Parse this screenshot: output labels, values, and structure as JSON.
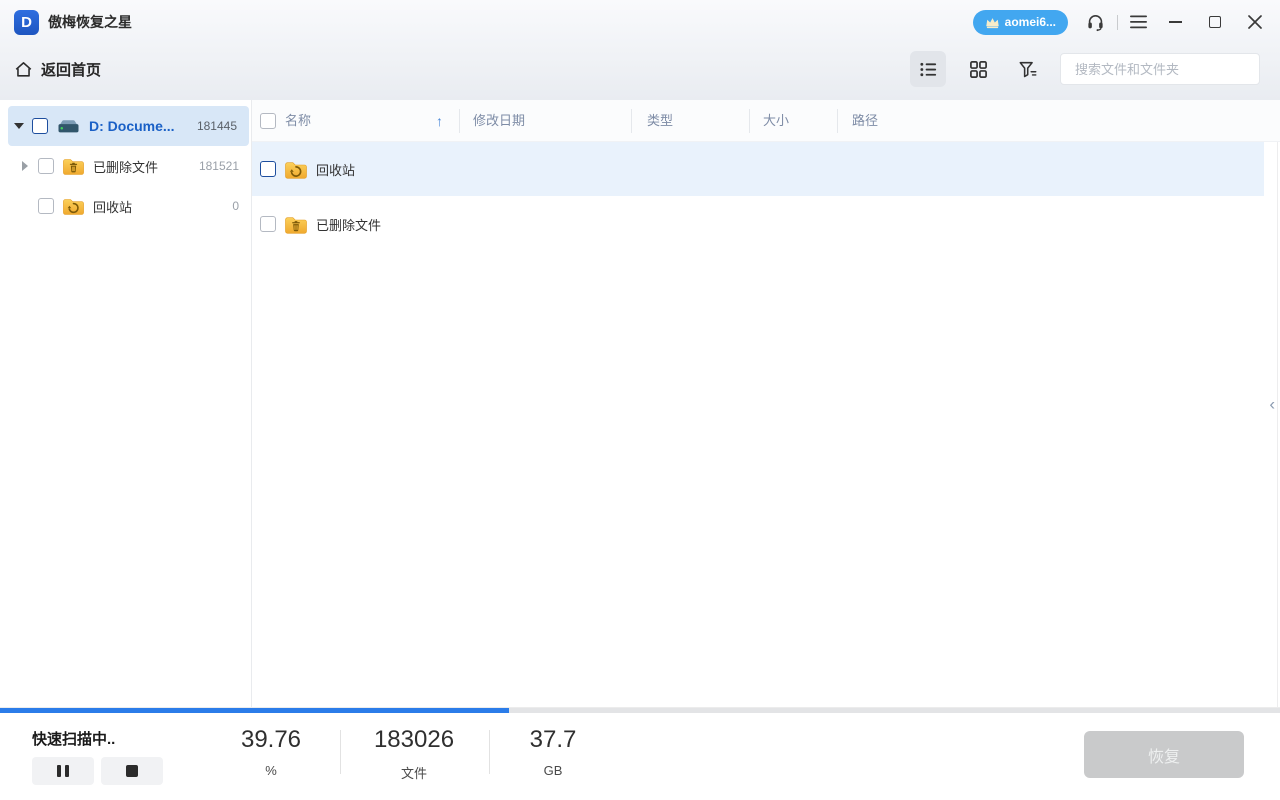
{
  "window": {
    "title": "傲梅恢复之星"
  },
  "titlebar": {
    "account": {
      "label": "aomei6..."
    }
  },
  "toolbar": {
    "back_home_label": "返回首页",
    "search_placeholder": "搜索文件和文件夹"
  },
  "sidebar": {
    "items": [
      {
        "label": "D: Docume...",
        "count": "181445",
        "icon": "drive",
        "selected": true,
        "expanded": true
      },
      {
        "label": "已删除文件",
        "count": "181521",
        "icon": "folder-trash",
        "selected": false
      },
      {
        "label": "回收站",
        "count": "0",
        "icon": "folder-recycle",
        "selected": false
      }
    ]
  },
  "filetable": {
    "columns": [
      {
        "label": "名称",
        "sorted": "asc"
      },
      {
        "label": "修改日期"
      },
      {
        "label": "类型"
      },
      {
        "label": "大小"
      },
      {
        "label": "路径"
      }
    ],
    "sort_arrow": "↑",
    "rows": [
      {
        "name": "回收站",
        "icon": "folder-recycle",
        "highlighted": true
      },
      {
        "name": "已删除文件",
        "icon": "folder-trash",
        "highlighted": false
      }
    ]
  },
  "right_panel": {
    "collapse_glyph": "‹"
  },
  "statusbar": {
    "status_text": "快速扫描中..",
    "progress_percent": 39.76,
    "stats": [
      {
        "value": "39.76",
        "unit": "%"
      },
      {
        "value": "183026",
        "unit": "文件"
      },
      {
        "value": "37.7",
        "unit": "GB"
      }
    ],
    "recover_button_label": "恢复"
  },
  "colors": {
    "accent_blue": "#2b7ce9",
    "account_pill_blue": "#42a7f0",
    "selected_tree_bg": "#d8e7f7",
    "highlight_row_bg": "#e9f2fc",
    "folder_yellow": "#f7c143",
    "disabled_button_bg": "#c9cacb"
  }
}
